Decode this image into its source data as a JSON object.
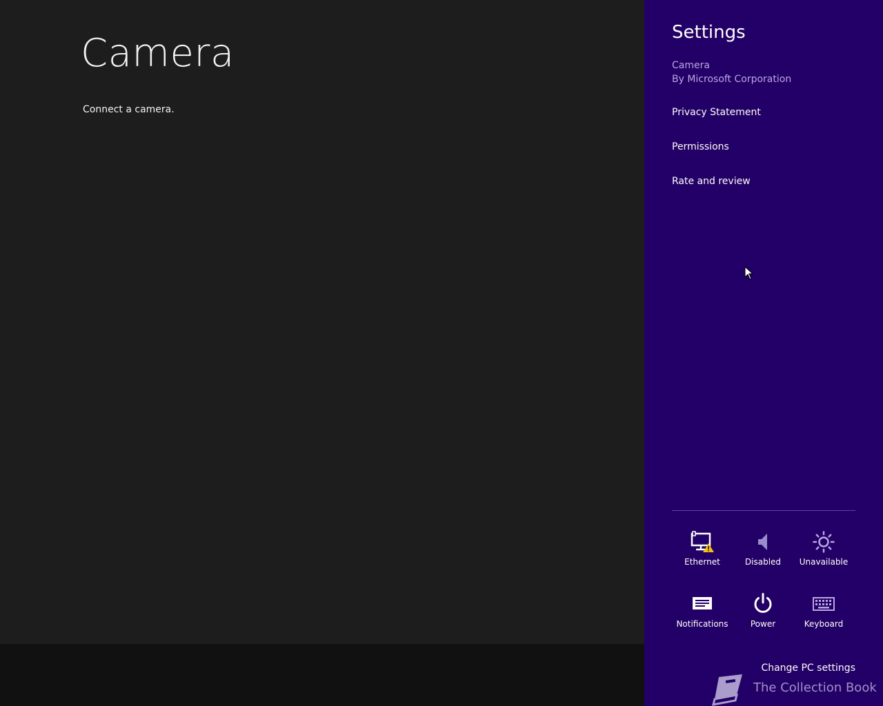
{
  "app": {
    "title": "Camera",
    "message": "Connect a camera."
  },
  "settings_pane": {
    "title": "Settings",
    "app_name": "Camera",
    "publisher": "By Microsoft Corporation",
    "menu": [
      {
        "label": "Privacy Statement"
      },
      {
        "label": "Permissions"
      },
      {
        "label": "Rate and review"
      }
    ],
    "quick_settings": [
      {
        "label": "Ethernet",
        "icon": "ethernet-warning-icon"
      },
      {
        "label": "Disabled",
        "icon": "speaker-icon"
      },
      {
        "label": "Unavailable",
        "icon": "brightness-icon"
      },
      {
        "label": "Notifications",
        "icon": "notifications-icon"
      },
      {
        "label": "Power",
        "icon": "power-icon"
      },
      {
        "label": "Keyboard",
        "icon": "keyboard-icon"
      }
    ],
    "change_pc_settings": "Change PC settings",
    "accent_color": "#220068"
  },
  "watermark": {
    "text": "The Collection Book",
    "icon": "book-icon"
  }
}
